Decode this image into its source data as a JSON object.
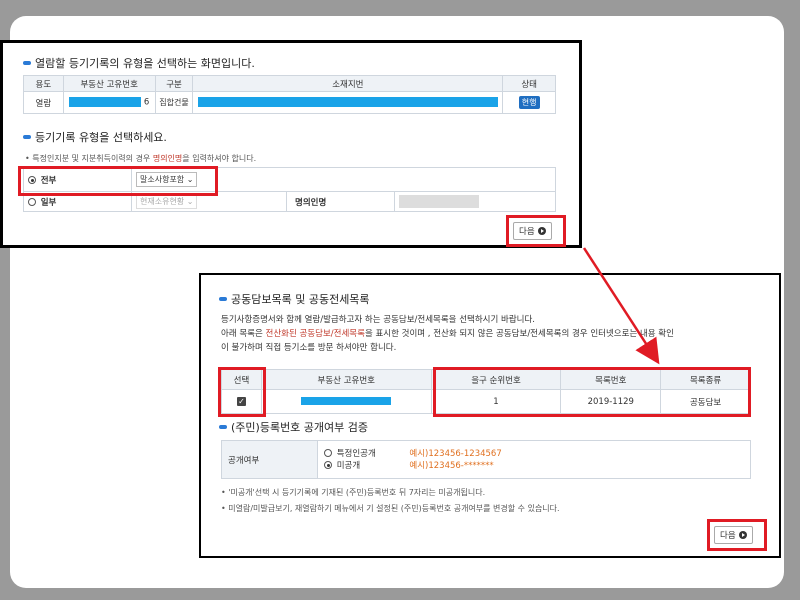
{
  "panel1": {
    "title": "열람할 등기기록의 유형을 선택하는 화면입니다.",
    "table_headers": [
      "용도",
      "부동산 고유번호",
      "구분",
      "소재지번",
      "상태"
    ],
    "row": {
      "usage": "열람",
      "unique_suffix": "6",
      "category": "집합건물",
      "status": "현행"
    },
    "section2_title": "등기기록 유형을 선택하세요.",
    "note_prefix": "• 특정인지분 및 지분취득이력의 경우 ",
    "note_highlight": "명의인명",
    "note_suffix": "을 입력하셔야 합니다.",
    "opt_all_label": "전부",
    "opt_all_select": "말소사항포함",
    "opt_part_label": "일부",
    "opt_part_select": "현재소유현황",
    "owner_name_label": "명의인명",
    "next_label": "다음"
  },
  "panel2": {
    "title": "공동담보목록 및 공동전세목록",
    "para1": "등기사항증명서와 함께 열람/발급하고자 하는 공동담보/전세목록을 선택하시기 바랍니다.",
    "para2_prefix": "아래 목록은 ",
    "para2_highlight": "전산화된 공동담보/전세목록",
    "para2_suffix": "을 표시한 것이며 , 전산화 되지 않은 공동담보/전세목록의 경우 인터넷으로는 내용 확인",
    "para3": "이 불가하며 직접 등기소를 방문 하셔야만 합니다.",
    "headers": [
      "선택",
      "부동산 고유번호",
      "을구 순위번호",
      "목록번호",
      "목록종류"
    ],
    "row": {
      "rank": "1",
      "list_no": "2019-1129",
      "list_type": "공동담보"
    },
    "section2_title": "(주민)등록번호 공개여부 검증",
    "public_label": "공개여부",
    "opt1_label": "특정인공개",
    "opt1_example": "예시)123456-1234567",
    "opt2_label": "미공개",
    "opt2_example": "예시)123456-*******",
    "bullet1": "• '미공개'선택 시 등기기록에 기재된 (주민)등록번호 뒤 7자리는 미공개됩니다.",
    "bullet2": "• 미열람/미발급보기, 재열람하기 메뉴에서 기 설정된 (주민)등록번호 공개여부를 변경할 수 있습니다.",
    "next_label": "다음"
  },
  "colors": {
    "accent": "#2a7ad6",
    "highlight": "#e01b24",
    "redacted": "#1aa3e8"
  }
}
